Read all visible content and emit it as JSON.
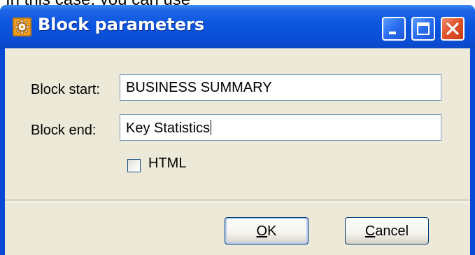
{
  "background_caption": "In this case, you can use",
  "window": {
    "title": "Block parameters",
    "controls": {
      "minimize_icon": "minimize-icon",
      "maximize_icon": "maximize-icon",
      "close_icon": "close-icon"
    }
  },
  "form": {
    "block_start": {
      "label": "Block start:",
      "value": "BUSINESS SUMMARY"
    },
    "block_end": {
      "label": "Block end:",
      "value": "Key Statistics"
    },
    "html_checkbox": {
      "label": "HTML",
      "checked": false
    }
  },
  "buttons": {
    "ok": {
      "mnemonic": "O",
      "rest": "K"
    },
    "cancel": {
      "mnemonic": "C",
      "rest": "ancel"
    }
  },
  "colors": {
    "titlebar": "#0a4fd8",
    "client": "#ece9d8",
    "close_button": "#e0502a"
  }
}
